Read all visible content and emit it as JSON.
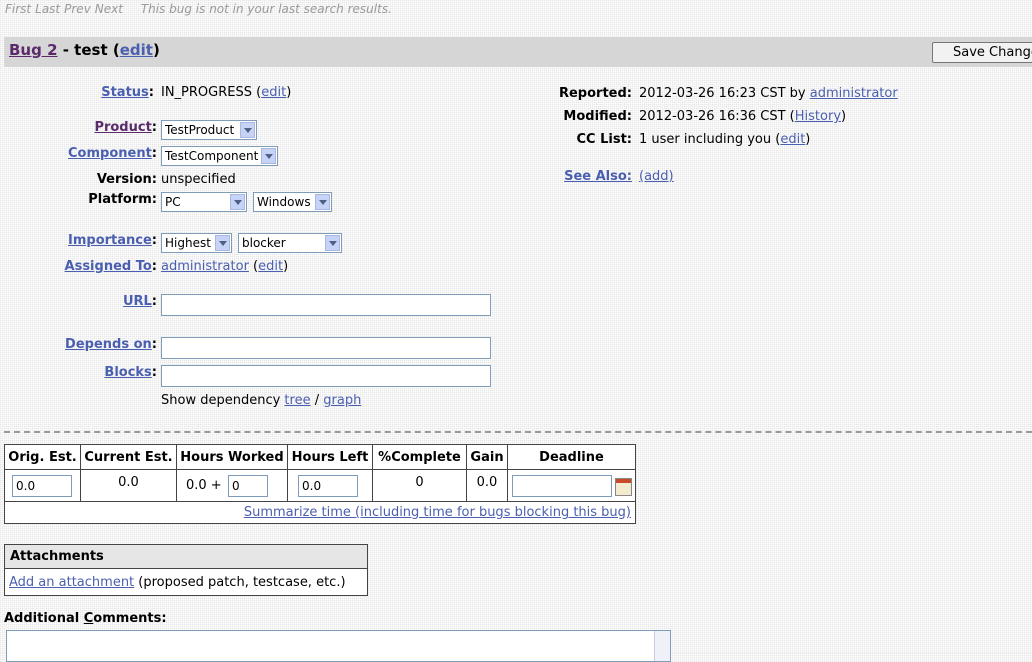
{
  "topnav": {
    "first": "First",
    "last": "Last",
    "prev": "Prev",
    "next": "Next",
    "note": "This bug is not in your last search results."
  },
  "header": {
    "bug_link": "Bug 2",
    "separator": " - test (",
    "edit": "edit",
    "close": ")",
    "save_button": "Save Changes"
  },
  "fields": {
    "status": {
      "label": "Status",
      "value": "IN_PROGRESS",
      "edit": "edit"
    },
    "product": {
      "label": "Product",
      "value": "TestProduct"
    },
    "component": {
      "label": "Component",
      "value": "TestComponent"
    },
    "version": {
      "label": "Version:",
      "value": "unspecified"
    },
    "platform": {
      "label": "Platform:",
      "hardware": "PC",
      "os": "Windows"
    },
    "importance": {
      "label": "Importance",
      "priority": "Highest",
      "severity": "blocker"
    },
    "assigned_to": {
      "label": "Assigned To",
      "value": "administrator",
      "edit": "edit"
    },
    "url": {
      "label": "URL",
      "value": ""
    },
    "depends_on": {
      "label": "Depends on",
      "value": ""
    },
    "blocks": {
      "label": "Blocks",
      "value": ""
    },
    "dependency": {
      "prefix": "Show dependency",
      "tree": "tree",
      "slash": "/",
      "graph": "graph"
    }
  },
  "right": {
    "reported_label": "Reported:",
    "reported_value": "2012-03-26 16:23 CST by",
    "reported_by": "administrator",
    "modified_label": "Modified:",
    "modified_value": "2012-03-26 16:36 CST (",
    "history": "History",
    "cc_label": "CC List:",
    "cc_value": "1 user including you (",
    "cc_edit": "edit",
    "see_also_label": "See Also:",
    "see_also_add": "(add)"
  },
  "time": {
    "headers": [
      "Orig. Est.",
      "Current Est.",
      "Hours Worked",
      "Hours Left",
      "%Complete",
      "Gain",
      "Deadline"
    ],
    "orig_est": "0.0",
    "current_est": "0.0",
    "hours_worked": "0.0 +",
    "hours_worked_input": "0",
    "hours_left": "0.0",
    "complete": "0",
    "gain": "0.0",
    "summarize": "Summarize time (including time for bugs blocking this bug)"
  },
  "attachments": {
    "header": "Attachments",
    "add_link": "Add an attachment",
    "add_note": "(proposed patch, testcase, etc.)"
  },
  "comments": {
    "label_pre": "Additional ",
    "label_u": "C",
    "label_post": "omments:"
  }
}
